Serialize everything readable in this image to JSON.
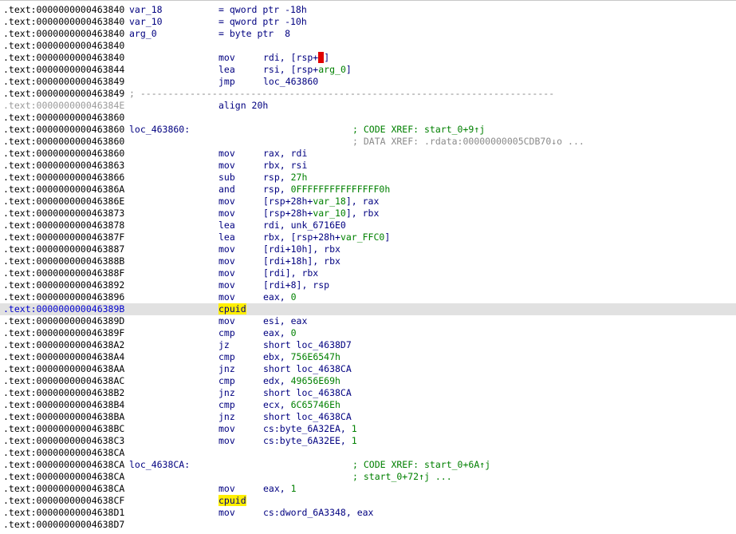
{
  "lines": [
    {
      "addr": ".text:0000000000463840",
      "label": "var_18",
      "ops": [
        {
          "t": "= qword ptr -18h"
        }
      ]
    },
    {
      "addr": ".text:0000000000463840",
      "label": "var_10",
      "ops": [
        {
          "t": "= qword ptr -10h"
        }
      ]
    },
    {
      "addr": ".text:0000000000463840",
      "label": "arg_0",
      "ops": [
        {
          "t": "= byte ptr  8"
        }
      ]
    },
    {
      "addr": ".text:0000000000463840"
    },
    {
      "addr": ".text:0000000000463840",
      "mnem": "mov",
      "ops": [
        {
          "t": "rdi, [rsp+"
        },
        {
          "t": "0",
          "k": "cursor"
        },
        {
          "t": "]"
        }
      ]
    },
    {
      "addr": ".text:0000000000463844",
      "mnem": "lea",
      "ops": [
        {
          "t": "rsi, [rsp+"
        },
        {
          "t": "arg_0",
          "k": "var"
        },
        {
          "t": "]"
        }
      ]
    },
    {
      "addr": ".text:0000000000463849",
      "mnem": "jmp",
      "ops": [
        {
          "t": "loc_463860"
        }
      ]
    },
    {
      "addr": ".text:0000000000463849",
      "sep": "; ---------------------------------------------------------------------------"
    },
    {
      "addr": ".text:000000000046384E",
      "addr_style": "gray",
      "mnem": "align 20h"
    },
    {
      "addr": ".text:0000000000463860"
    },
    {
      "addr": ".text:0000000000463860",
      "label": "loc_463860:",
      "cmt": "; CODE XREF: start_0+9↑j"
    },
    {
      "addr": ".text:0000000000463860",
      "cmt": "; DATA XREF: .rdata:00000000005CDB70↓o ...",
      "cmt_style": "gray"
    },
    {
      "addr": ".text:0000000000463860",
      "mnem": "mov",
      "ops": [
        {
          "t": "rax, rdi"
        }
      ]
    },
    {
      "addr": ".text:0000000000463863",
      "mnem": "mov",
      "ops": [
        {
          "t": "rbx, rsi"
        }
      ]
    },
    {
      "addr": ".text:0000000000463866",
      "mnem": "sub",
      "ops": [
        {
          "t": "rsp, "
        },
        {
          "t": "27h",
          "k": "num"
        }
      ]
    },
    {
      "addr": ".text:000000000046386A",
      "mnem": "and",
      "ops": [
        {
          "t": "rsp, "
        },
        {
          "t": "0FFFFFFFFFFFFFFF0h",
          "k": "num"
        }
      ]
    },
    {
      "addr": ".text:000000000046386E",
      "mnem": "mov",
      "ops": [
        {
          "t": "[rsp+28h+"
        },
        {
          "t": "var_18",
          "k": "var"
        },
        {
          "t": "], rax"
        }
      ]
    },
    {
      "addr": ".text:0000000000463873",
      "mnem": "mov",
      "ops": [
        {
          "t": "[rsp+28h+"
        },
        {
          "t": "var_10",
          "k": "var"
        },
        {
          "t": "], rbx"
        }
      ]
    },
    {
      "addr": ".text:0000000000463878",
      "mnem": "lea",
      "ops": [
        {
          "t": "rdi, unk_6716E0"
        }
      ]
    },
    {
      "addr": ".text:000000000046387F",
      "mnem": "lea",
      "ops": [
        {
          "t": "rbx, [rsp+28h+"
        },
        {
          "t": "var_FFC0",
          "k": "var"
        },
        {
          "t": "]"
        }
      ]
    },
    {
      "addr": ".text:0000000000463887",
      "mnem": "mov",
      "ops": [
        {
          "t": "[rdi+10h], rbx"
        }
      ]
    },
    {
      "addr": ".text:000000000046388B",
      "mnem": "mov",
      "ops": [
        {
          "t": "[rdi+18h], rbx"
        }
      ]
    },
    {
      "addr": ".text:000000000046388F",
      "mnem": "mov",
      "ops": [
        {
          "t": "[rdi], rbx"
        }
      ]
    },
    {
      "addr": ".text:0000000000463892",
      "mnem": "mov",
      "ops": [
        {
          "t": "[rdi+8], rsp"
        }
      ]
    },
    {
      "addr": ".text:0000000000463896",
      "mnem": "mov",
      "ops": [
        {
          "t": "eax, "
        },
        {
          "t": "0",
          "k": "num"
        }
      ]
    },
    {
      "addr": ".text:000000000046389B",
      "addr_style": "sel",
      "mnem": "cpuid",
      "mnem_hl": true,
      "row_hl": true
    },
    {
      "addr": ".text:000000000046389D",
      "mnem": "mov",
      "ops": [
        {
          "t": "esi, eax"
        }
      ]
    },
    {
      "addr": ".text:000000000046389F",
      "mnem": "cmp",
      "ops": [
        {
          "t": "eax, "
        },
        {
          "t": "0",
          "k": "num"
        }
      ]
    },
    {
      "addr": ".text:00000000004638A2",
      "mnem": "jz",
      "ops": [
        {
          "t": "short loc_4638D7"
        }
      ]
    },
    {
      "addr": ".text:00000000004638A4",
      "mnem": "cmp",
      "ops": [
        {
          "t": "ebx, "
        },
        {
          "t": "756E6547h",
          "k": "num"
        }
      ]
    },
    {
      "addr": ".text:00000000004638AA",
      "mnem": "jnz",
      "ops": [
        {
          "t": "short loc_4638CA"
        }
      ]
    },
    {
      "addr": ".text:00000000004638AC",
      "mnem": "cmp",
      "ops": [
        {
          "t": "edx, "
        },
        {
          "t": "49656E69h",
          "k": "num"
        }
      ]
    },
    {
      "addr": ".text:00000000004638B2",
      "mnem": "jnz",
      "ops": [
        {
          "t": "short loc_4638CA"
        }
      ]
    },
    {
      "addr": ".text:00000000004638B4",
      "mnem": "cmp",
      "ops": [
        {
          "t": "ecx, "
        },
        {
          "t": "6C65746Eh",
          "k": "num"
        }
      ]
    },
    {
      "addr": ".text:00000000004638BA",
      "mnem": "jnz",
      "ops": [
        {
          "t": "short loc_4638CA"
        }
      ]
    },
    {
      "addr": ".text:00000000004638BC",
      "mnem": "mov",
      "ops": [
        {
          "t": "cs:byte_6A32EA, "
        },
        {
          "t": "1",
          "k": "num"
        }
      ]
    },
    {
      "addr": ".text:00000000004638C3",
      "mnem": "mov",
      "ops": [
        {
          "t": "cs:byte_6A32EE, "
        },
        {
          "t": "1",
          "k": "num"
        }
      ]
    },
    {
      "addr": ".text:00000000004638CA"
    },
    {
      "addr": ".text:00000000004638CA",
      "label": "loc_4638CA:",
      "cmt": "; CODE XREF: start_0+6A↑j"
    },
    {
      "addr": ".text:00000000004638CA",
      "cmt": "; start_0+72↑j ..."
    },
    {
      "addr": ".text:00000000004638CA",
      "mnem": "mov",
      "ops": [
        {
          "t": "eax, "
        },
        {
          "t": "1",
          "k": "num"
        }
      ]
    },
    {
      "addr": ".text:00000000004638CF",
      "mnem": "cpuid",
      "mnem_hl": true
    },
    {
      "addr": ".text:00000000004638D1",
      "mnem": "mov",
      "ops": [
        {
          "t": "cs:dword_6A3348, eax"
        }
      ]
    },
    {
      "addr": ".text:00000000004638D7"
    }
  ]
}
